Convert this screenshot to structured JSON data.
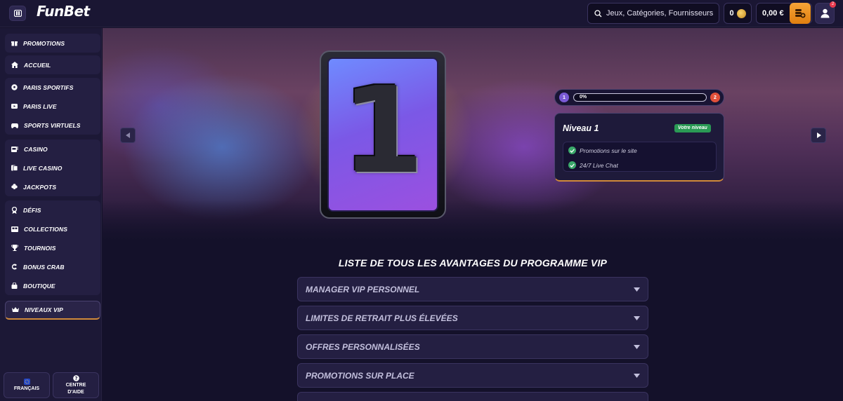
{
  "header": {
    "logo": "FunBet",
    "search_placeholder": "Jeux, Catégories, Fournisseurs",
    "coins": "0",
    "balance": "0,00 €",
    "notifications": "2"
  },
  "sidebar": {
    "groups": [
      {
        "items": [
          {
            "label": "PROMOTIONS",
            "icon": "gift-icon"
          }
        ]
      },
      {
        "items": [
          {
            "label": "ACCUEIL",
            "icon": "home-icon"
          }
        ]
      },
      {
        "items": [
          {
            "label": "PARIS SPORTIFS",
            "icon": "soccer-ball-icon"
          },
          {
            "label": "PARIS LIVE",
            "icon": "live-tv-icon"
          },
          {
            "label": "SPORTS VIRTUELS",
            "icon": "gamepad-icon"
          }
        ]
      },
      {
        "items": [
          {
            "label": "CASINO",
            "icon": "slot-machine-icon"
          },
          {
            "label": "LIVE CASINO",
            "icon": "cards-icon"
          },
          {
            "label": "JACKPOTS",
            "icon": "clover-icon"
          }
        ]
      },
      {
        "items": [
          {
            "label": "DÉFIS",
            "icon": "medal-icon"
          },
          {
            "label": "COLLECTIONS",
            "icon": "album-icon"
          },
          {
            "label": "TOURNOIS",
            "icon": "trophy-icon"
          },
          {
            "label": "BONUS CRAB",
            "icon": "crab-icon"
          },
          {
            "label": "BOUTIQUE",
            "icon": "shop-icon"
          }
        ]
      }
    ],
    "active_item": {
      "label": "NIVEAUX VIP",
      "icon": "crown-icon"
    },
    "footer": {
      "language": "FRANÇAIS",
      "help_line1": "CENTRE",
      "help_line2": "D'AIDE"
    }
  },
  "hero": {
    "card_number": "1",
    "progress": {
      "current_level": "1",
      "next_level": "2",
      "percent_label": "0%",
      "value": 0
    },
    "level_card": {
      "title": "Niveau 1",
      "badge": "Votre niveau",
      "perks": [
        "Promotions sur le site",
        "24/7 Live Chat"
      ]
    }
  },
  "benefits": {
    "title": "LISTE DE TOUS LES AVANTAGES DU PROGRAMME VIP",
    "items": [
      "MANAGER VIP PERSONNEL",
      "LIMITES DE RETRAIT PLUS ÉLEVÉES",
      "OFFRES PERSONNALISÉES",
      "PROMOTIONS SUR PLACE"
    ]
  },
  "colors": {
    "accent_orange": "#e88a1e",
    "success_green": "#2a9a55",
    "panel": "#241f42",
    "background": "#14112a"
  }
}
